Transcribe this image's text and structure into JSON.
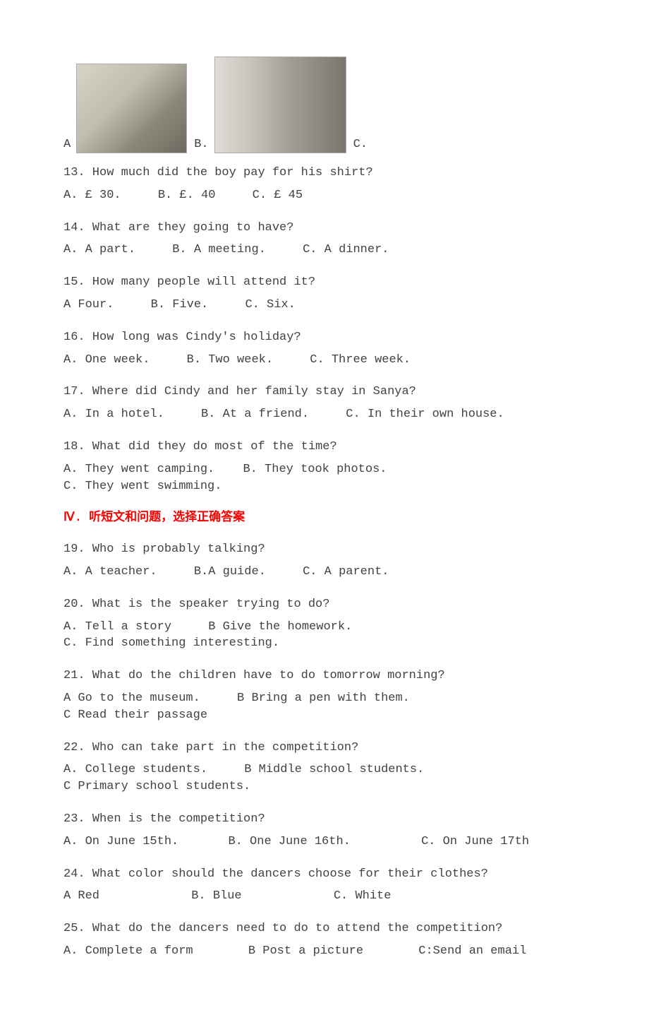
{
  "imageRow": {
    "labelA": "A",
    "labelB": "B.",
    "labelC": "C."
  },
  "sectionHeading": "Ⅳ. 听短文和问题，选择正确答案",
  "questions": {
    "q13": {
      "prompt": "13. How much did the boy pay for his shirt?",
      "a": "A. £ 30.",
      "b": "B. £. 40",
      "c": "C. £ 45"
    },
    "q14": {
      "prompt": "14. What are they going to have?",
      "a": "A. A part.",
      "b": "B. A meeting.",
      "c": "C. A dinner."
    },
    "q15": {
      "prompt": "15. How many people will attend it?",
      "a": "A Four.",
      "b": "B. Five.",
      "c": "C. Six."
    },
    "q16": {
      "prompt": "16. How long was Cindy's holiday?",
      "a": "A. One week.",
      "b": "B. Two week.",
      "c": "C. Three week."
    },
    "q17": {
      "prompt": "17. Where did Cindy and her family stay in Sanya?",
      "a": "A. In a hotel.",
      "b": "B. At a friend.",
      "c": "C. In their own house."
    },
    "q18": {
      "prompt": "18. What did they do most of the time?",
      "a": "A. They went camping.",
      "b": "B. They took photos.",
      "c": "C. They went swimming."
    },
    "q19": {
      "prompt": "19. Who is probably talking?",
      "a": "A. A teacher.",
      "b": "B.A guide.",
      "c": "C. A parent."
    },
    "q20": {
      "prompt": "20. What is the speaker trying to do?",
      "a": "A. Tell a story",
      "b": "B Give the homework.",
      "c": "C. Find something interesting."
    },
    "q21": {
      "prompt": "21. What do the children have to do tomorrow morning?",
      "a": " A Go to the museum.",
      "b": "B Bring a pen with them.",
      "c": "C Read their passage"
    },
    "q22": {
      "prompt": "22. Who can take part in the competition?",
      "a": "A. College students.",
      "b": "B Middle school students.",
      "c": "C Primary school students."
    },
    "q23": {
      "prompt": "23. When is the competition?",
      "a": "A. On June 15th.",
      "b": "B. One June 16th.",
      "c": "C. On June 17th"
    },
    "q24": {
      "prompt": "24. What color should the dancers choose for their clothes?",
      "a": "A Red",
      "b": "B. Blue",
      "c": "C. White"
    },
    "q25": {
      "prompt": "25. What do the dancers need to do to attend the competition?",
      "a": "A. Complete a form",
      "b": "B Post a picture",
      "c": "C:Send an email"
    }
  }
}
